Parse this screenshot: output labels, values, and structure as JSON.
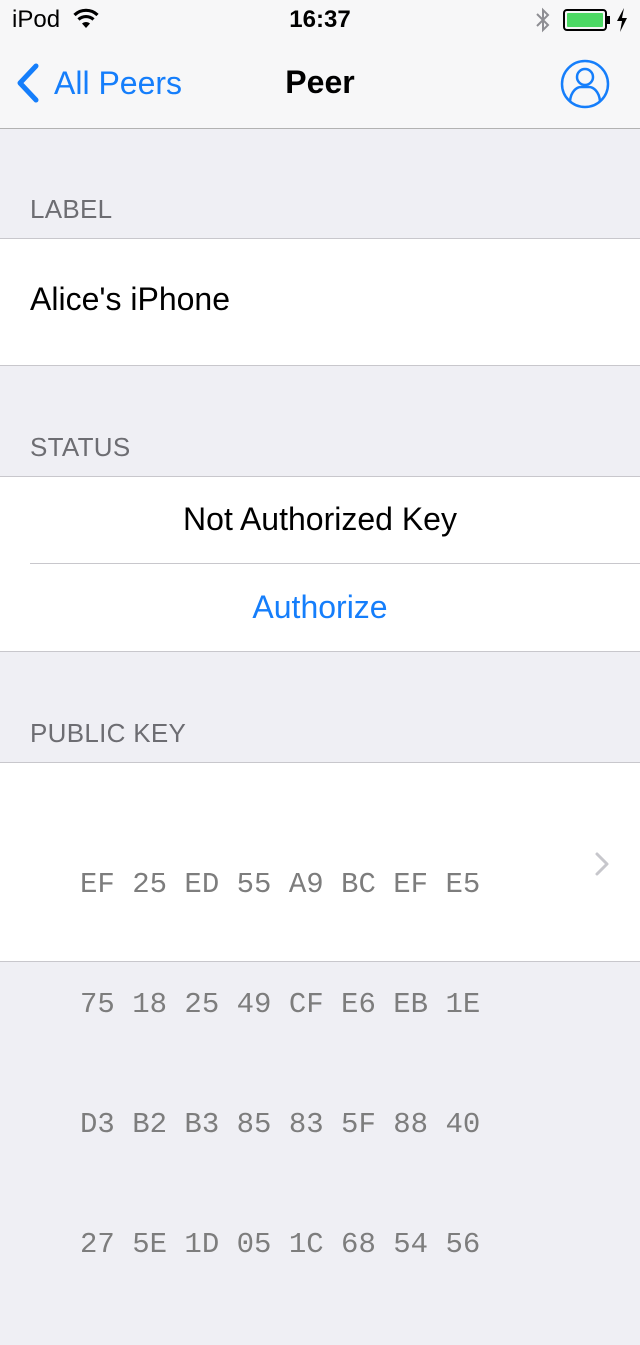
{
  "status_bar": {
    "carrier": "iPod",
    "time": "16:37",
    "icons": [
      "wifi-icon",
      "bluetooth-icon",
      "battery-icon",
      "charging-icon"
    ],
    "battery_color": "#4cd964"
  },
  "nav": {
    "back_label": "All Peers",
    "title": "Peer",
    "right_icon": "profile-icon",
    "tint": "#157efb"
  },
  "sections": {
    "label": {
      "header": "LABEL",
      "value": "Alice's iPhone"
    },
    "status": {
      "header": "STATUS",
      "value": "Not Authorized Key",
      "action_label": "Authorize"
    },
    "public_key": {
      "header": "PUBLIC KEY",
      "lines": [
        "EF 25 ED 55 A9 BC EF E5",
        "75 18 25 49 CF E6 EB 1E",
        "D3 B2 B3 85 83 5F 88 40",
        "27 5E 1D 05 1C 68 54 56"
      ]
    }
  }
}
